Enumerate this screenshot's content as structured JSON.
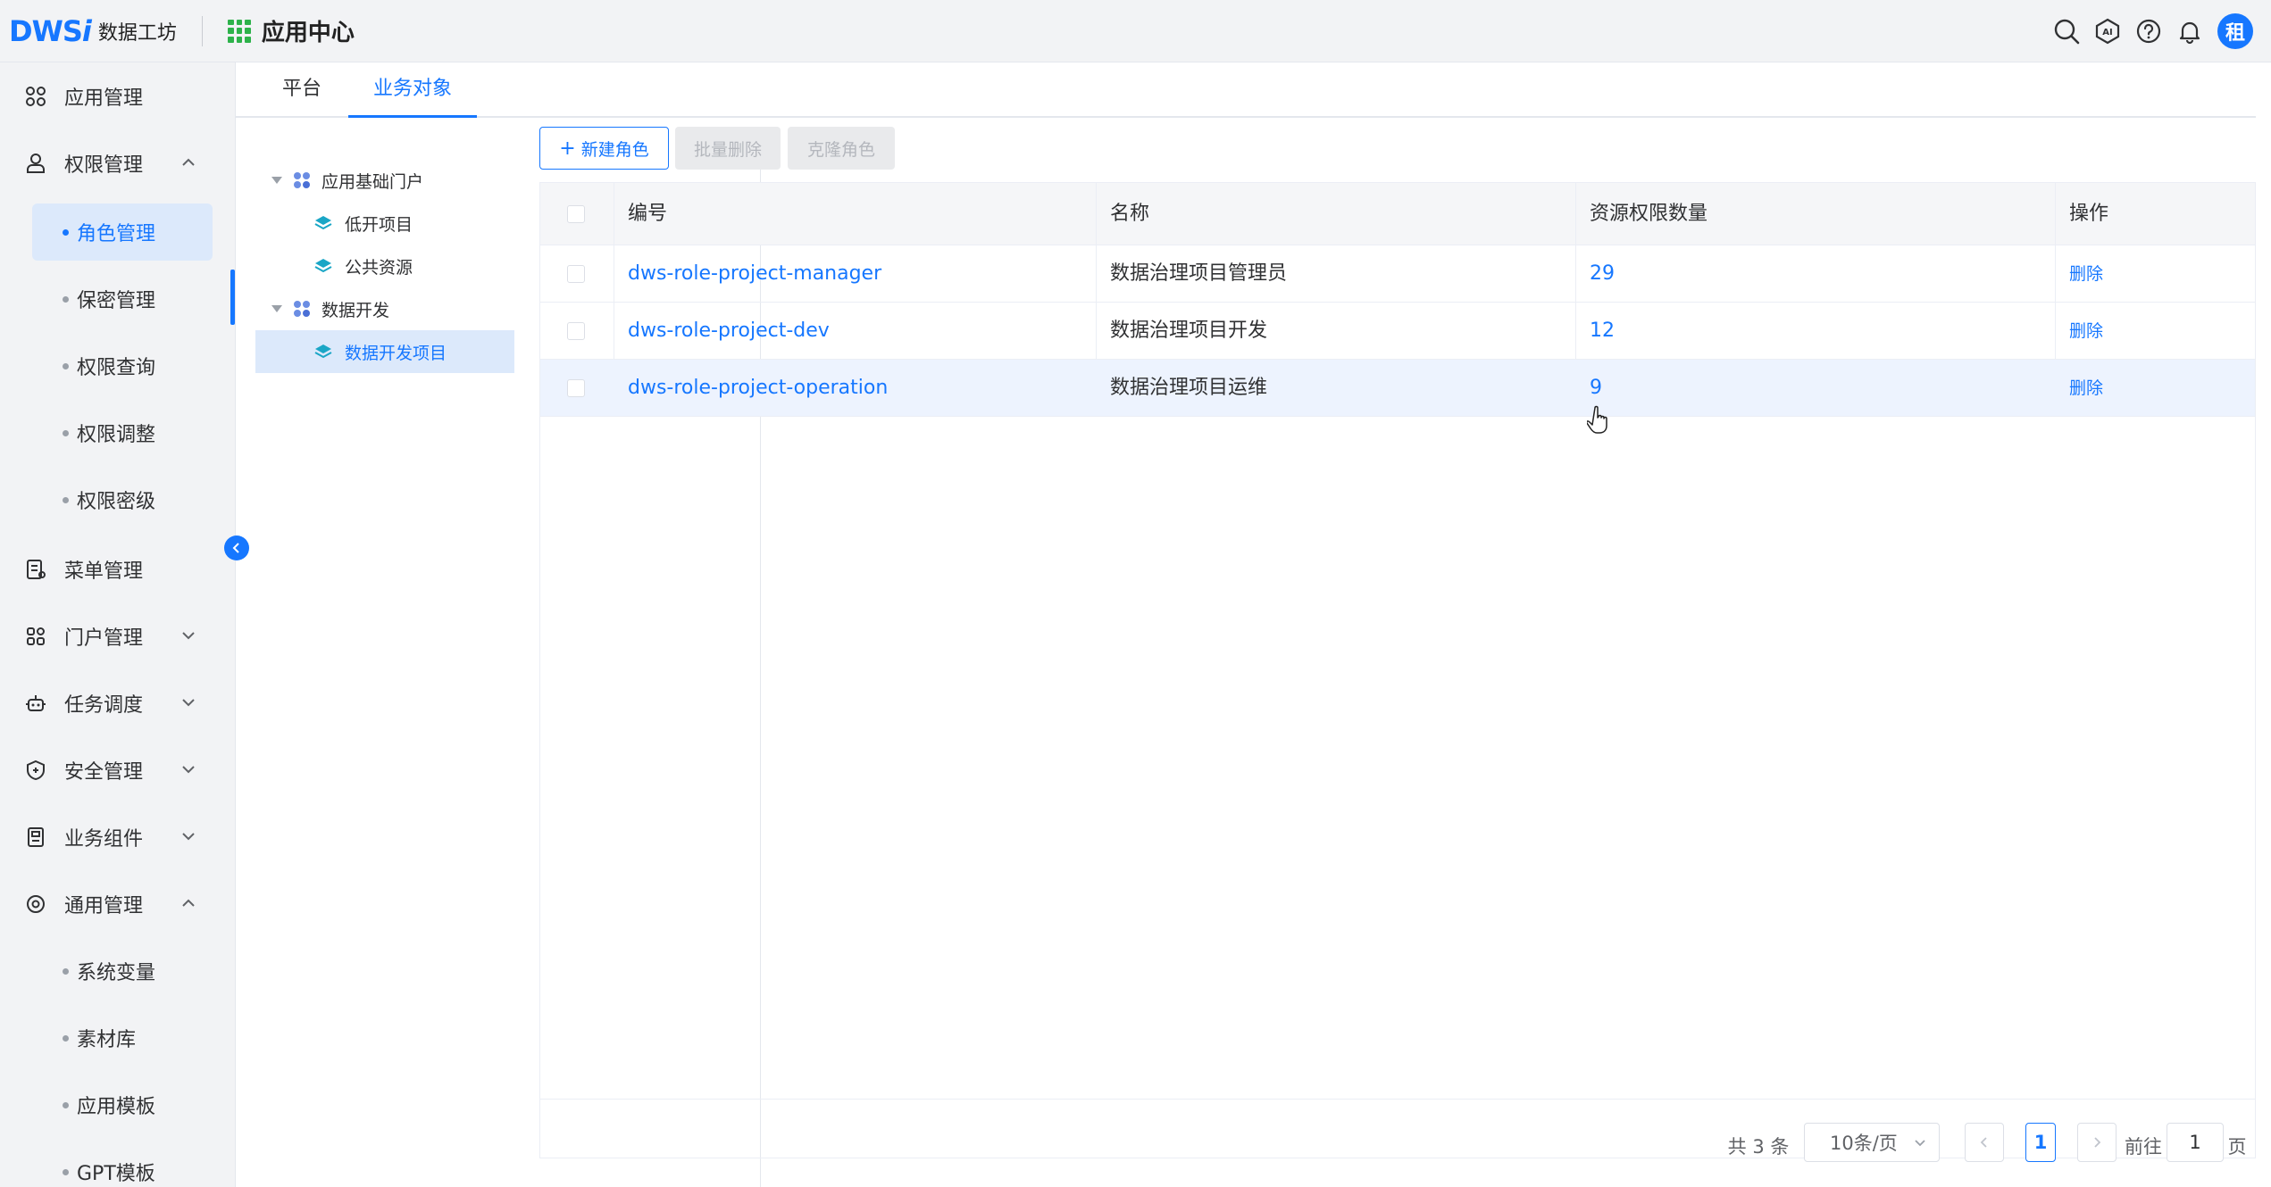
{
  "header": {
    "logo_mark": "DWS",
    "logo_mark_i": "i",
    "logo_text": "数据工坊",
    "app_title": "应用中心",
    "avatar_text": "租",
    "icons": [
      "search-icon",
      "ai-icon",
      "help-icon",
      "bell-icon"
    ]
  },
  "sidebar": {
    "groups": [
      {
        "label": "应用管理",
        "icon": "apps-icon"
      },
      {
        "label": "权限管理",
        "icon": "user-lock-icon",
        "expanded": true
      },
      {
        "label": "菜单管理",
        "icon": "menu-doc-icon"
      },
      {
        "label": "门户管理",
        "icon": "portal-icon"
      },
      {
        "label": "任务调度",
        "icon": "robot-icon"
      },
      {
        "label": "安全管理",
        "icon": "shield-icon"
      },
      {
        "label": "业务组件",
        "icon": "component-icon"
      },
      {
        "label": "通用管理",
        "icon": "settings-icon",
        "expanded": true
      }
    ],
    "perm_items": [
      {
        "label": "角色管理",
        "active": true
      },
      {
        "label": "保密管理"
      },
      {
        "label": "权限查询"
      },
      {
        "label": "权限调整"
      },
      {
        "label": "权限密级"
      }
    ],
    "general_items": [
      {
        "label": "系统变量"
      },
      {
        "label": "素材库"
      },
      {
        "label": "应用模板"
      },
      {
        "label": "GPT模板"
      }
    ]
  },
  "tabs": [
    {
      "label": "平台"
    },
    {
      "label": "业务对象",
      "active": true
    }
  ],
  "tree": {
    "nodes": [
      {
        "label": "应用基础门户",
        "level": 0
      },
      {
        "label": "低开项目",
        "level": 1
      },
      {
        "label": "公共资源",
        "level": 1
      },
      {
        "label": "数据开发",
        "level": 0
      },
      {
        "label": "数据开发项目",
        "level": 1,
        "selected": true
      }
    ]
  },
  "toolbar": {
    "new_role": "新建角色",
    "batch_delete": "批量删除",
    "clone_role": "克隆角色"
  },
  "table": {
    "columns": [
      "编号",
      "名称",
      "资源权限数量",
      "操作"
    ],
    "rows": [
      {
        "code": "dws-role-project-manager",
        "name": "数据治理项目管理员",
        "count": "29",
        "op": "删除"
      },
      {
        "code": "dws-role-project-dev",
        "name": "数据治理项目开发",
        "count": "12",
        "op": "删除"
      },
      {
        "code": "dws-role-project-operation",
        "name": "数据治理项目运维",
        "count": "9",
        "op": "删除"
      }
    ]
  },
  "pagination": {
    "total": "共 3 条",
    "page_size": "10条/页",
    "current_page": "1",
    "goto_label": "前往",
    "goto_value": "1",
    "page_suffix": "页"
  },
  "colors": {
    "primary": "#1677ff",
    "active_bg": "#dce9fb",
    "logo_green": "#2db24a"
  }
}
